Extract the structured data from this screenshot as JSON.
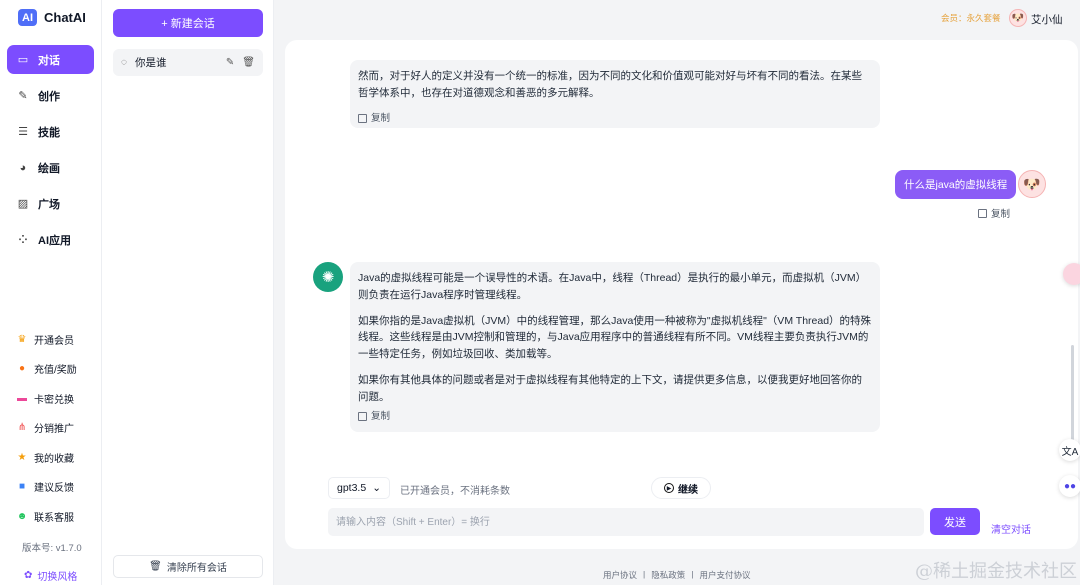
{
  "app": {
    "logo_badge": "AI",
    "name": "ChatAI"
  },
  "nav": {
    "items": [
      {
        "label": "对话",
        "icon": "chat-bubble-icon",
        "active": true
      },
      {
        "label": "创作",
        "icon": "pen-icon"
      },
      {
        "label": "技能",
        "icon": "list-icon"
      },
      {
        "label": "绘画",
        "icon": "palette-icon"
      },
      {
        "label": "广场",
        "icon": "image-icon"
      },
      {
        "label": "AI应用",
        "icon": "apps-grid-icon"
      }
    ],
    "sub_items": [
      {
        "label": "开通会员",
        "icon": "crown-icon",
        "color": "#f59e0b"
      },
      {
        "label": "充值/奖励",
        "icon": "coin-icon",
        "color": "#f97316"
      },
      {
        "label": "卡密兑换",
        "icon": "card-icon",
        "color": "#ec4899"
      },
      {
        "label": "分销推广",
        "icon": "share-tree-icon",
        "color": "#ef4444"
      },
      {
        "label": "我的收藏",
        "icon": "star-icon",
        "color": "#f59e0b"
      },
      {
        "label": "建议反馈",
        "icon": "feedback-icon",
        "color": "#3b82f6"
      },
      {
        "label": "联系客服",
        "icon": "support-icon",
        "color": "#22c55e"
      }
    ],
    "version": "版本号: v1.7.0",
    "theme_toggle": "切换风格"
  },
  "conversations": {
    "new_button": "+ 新建会话",
    "items": [
      {
        "title": "你是谁"
      }
    ],
    "clear_all": "清除所有会话"
  },
  "topbar": {
    "member_text": "会员：永久套餐",
    "user_name": "艾小仙"
  },
  "chat": {
    "messages": [
      {
        "role": "assistant",
        "paragraphs": [
          "然而，对于好人的定义并没有一个统一的标准，因为不同的文化和价值观可能对好与坏有不同的看法。在某些哲学体系中，也存在对道德观念和善恶的多元解释。"
        ],
        "copy": "复制"
      },
      {
        "role": "user",
        "text": "什么是java的虚拟线程",
        "copy": "复制"
      },
      {
        "role": "assistant",
        "paragraphs": [
          "Java的虚拟线程可能是一个误导性的术语。在Java中，线程（Thread）是执行的最小单元，而虚拟机（JVM）则负责在运行Java程序时管理线程。",
          "如果你指的是Java虚拟机（JVM）中的线程管理，那么Java使用一种被称为\"虚拟机线程\"（VM Thread）的特殊线程。这些线程是由JVM控制和管理的，与Java应用程序中的普通线程有所不同。VM线程主要负责执行JVM的一些特定任务，例如垃圾回收、类加载等。",
          "如果你有其他具体的问题或者是对于虚拟线程有其他特定的上下文，请提供更多信息，以便我更好地回答你的问题。"
        ],
        "copy": "复制"
      }
    ],
    "model": "gpt3.5",
    "model_note": "已开通会员，不消耗条数",
    "continue": "继续",
    "input_placeholder": "请输入内容（Shift + Enter）= 换行",
    "send": "发送",
    "clear_chat": "清空对话"
  },
  "footer": {
    "links": [
      "用户协议",
      "隐私政策",
      "用户支付协议"
    ],
    "separator": "|"
  },
  "watermark": "@稀土掘金技术社区",
  "colors": {
    "accent": "#7c4dff",
    "bubble_user": "#8b5cf6",
    "bot_avatar": "#19a27e",
    "member": "#e6a23c"
  }
}
